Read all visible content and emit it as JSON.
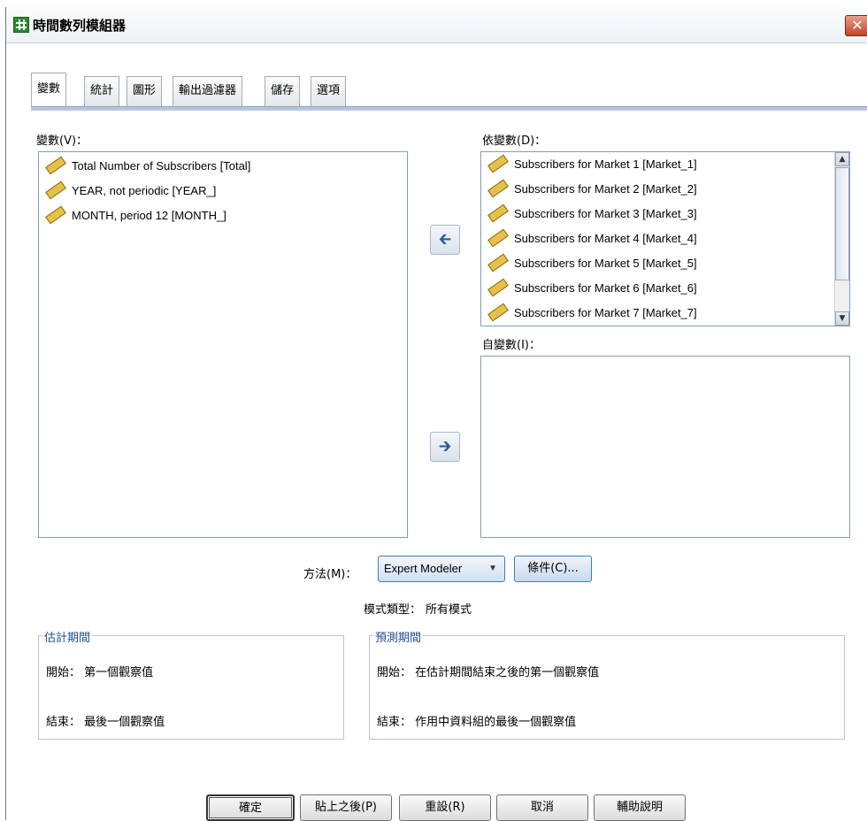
{
  "window": {
    "title": "時間數列模組器",
    "close_glyph": "✕"
  },
  "tabs": [
    {
      "label": "變數",
      "active": true
    },
    {
      "label": "統計",
      "active": false
    },
    {
      "label": "圖形",
      "active": false
    },
    {
      "label": "輸出過濾器",
      "active": false
    },
    {
      "label": "儲存",
      "active": false
    },
    {
      "label": "選項",
      "active": false
    }
  ],
  "variables": {
    "label": "變數(V)：",
    "items": [
      {
        "label": "Total Number of Subscribers [Total]",
        "icon": "scale-ruler-icon"
      },
      {
        "label": "YEAR, not periodic [YEAR_]",
        "icon": "scale-ruler-icon"
      },
      {
        "label": "MONTH, period 12 [MONTH_]",
        "icon": "scale-ruler-icon"
      }
    ]
  },
  "dependent": {
    "label": "依變數(D)：",
    "items": [
      {
        "label": "Subscribers for Market 1 [Market_1]",
        "icon": "scale-ruler-icon"
      },
      {
        "label": "Subscribers for Market 2 [Market_2]",
        "icon": "scale-ruler-icon"
      },
      {
        "label": "Subscribers for Market 3 [Market_3]",
        "icon": "scale-ruler-icon"
      },
      {
        "label": "Subscribers for Market 4 [Market_4]",
        "icon": "scale-ruler-icon"
      },
      {
        "label": "Subscribers for Market 5 [Market_5]",
        "icon": "scale-ruler-icon"
      },
      {
        "label": "Subscribers for Market 6 [Market_6]",
        "icon": "scale-ruler-icon"
      },
      {
        "label": "Subscribers for Market 7 [Market_7]",
        "icon": "scale-ruler-icon"
      }
    ]
  },
  "independent": {
    "label": "自變數(I)："
  },
  "move_buttons": {
    "to_variables_glyph": "🡰",
    "to_independent_glyph": "🡲"
  },
  "method": {
    "label": "方法(M)：",
    "selected": "Expert Modeler",
    "criteria_button": "條件(C)...",
    "model_type_label": "模式類型：",
    "model_type_value": "所有模式"
  },
  "estimation": {
    "title": "估計期間",
    "start_label": "開始：",
    "start_value": "第一個觀察值",
    "end_label": "結束：",
    "end_value": "最後一個觀察值"
  },
  "forecast": {
    "title": "預測期間",
    "start_label": "開始：",
    "start_value": "在估計期間結束之後的第一個觀察值",
    "end_label": "結束：",
    "end_value": "作用中資料組的最後一個觀察值"
  },
  "footer_buttons": {
    "ok": "確定",
    "paste": "貼上之後(P)",
    "reset": "重設(R)",
    "cancel": "取消",
    "help": "輔助說明"
  }
}
